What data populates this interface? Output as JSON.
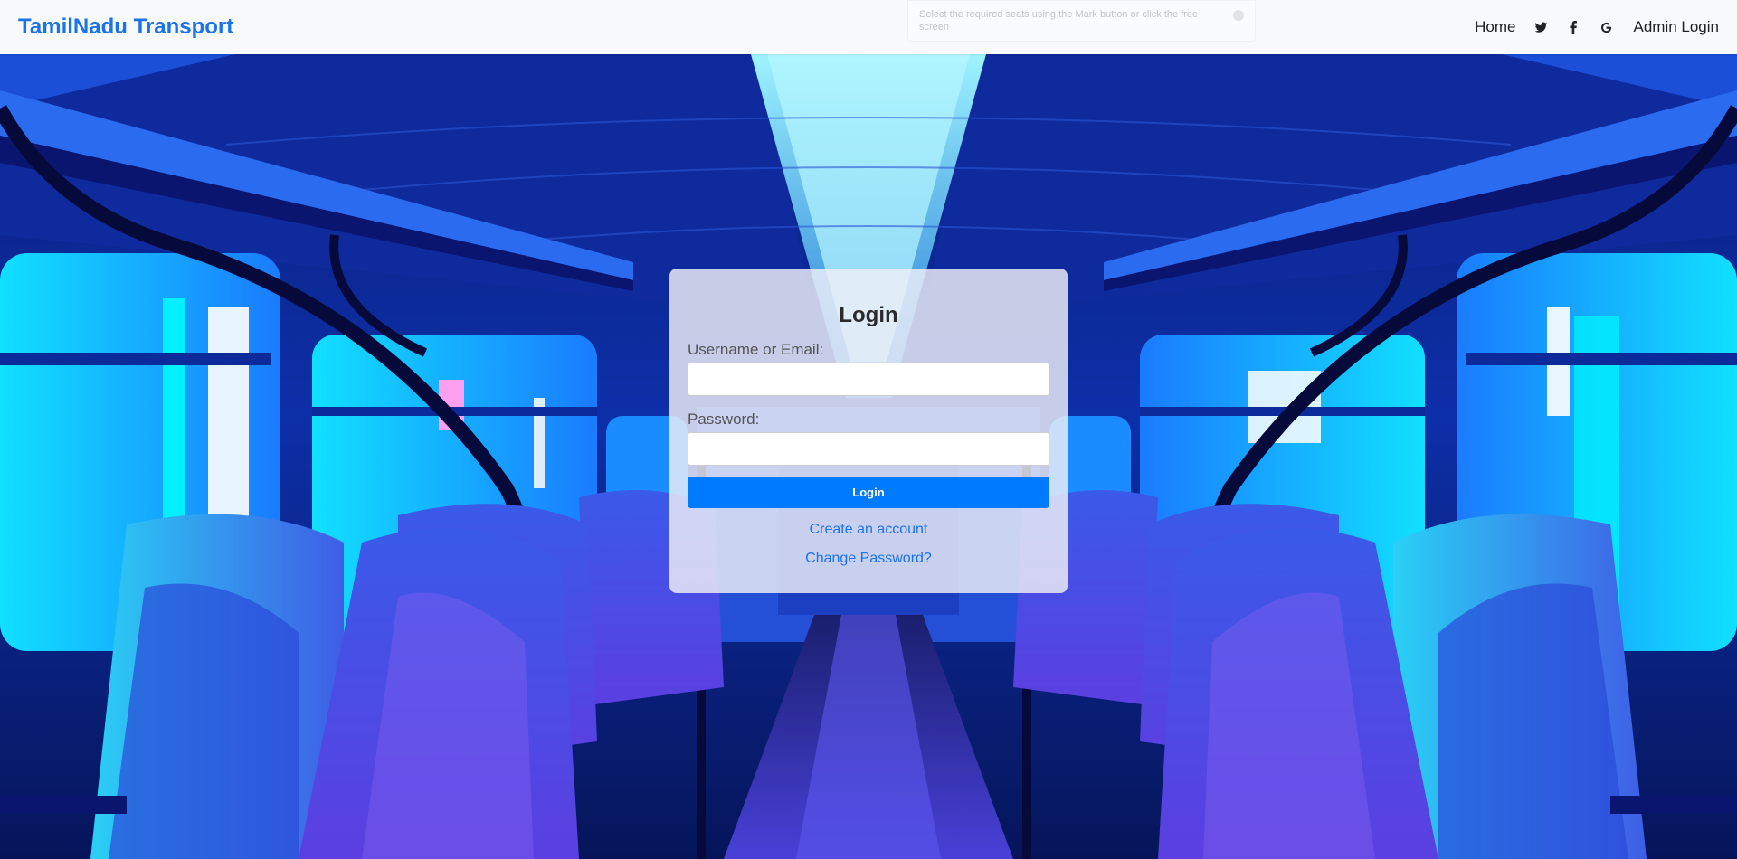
{
  "navbar": {
    "brand": "TamilNadu Transport",
    "home_label": "Home",
    "icons": [
      "twitter-icon",
      "facebook-icon",
      "google-icon"
    ],
    "admin_label": "Admin Login"
  },
  "toast": {
    "text": "Select the required seats using the Mark button or click the free",
    "text2": "screen"
  },
  "login": {
    "title": "Login",
    "username_label": "Username or Email:",
    "username_value": "",
    "password_label": "Password:",
    "password_value": "",
    "button_label": "Login",
    "create_account_label": "Create an account",
    "change_password_label": "Change Password?"
  },
  "colors": {
    "brand": "#1a73e8",
    "button": "#007bff",
    "link": "#1a73e8",
    "navbar_bg": "#f8f9fa"
  }
}
